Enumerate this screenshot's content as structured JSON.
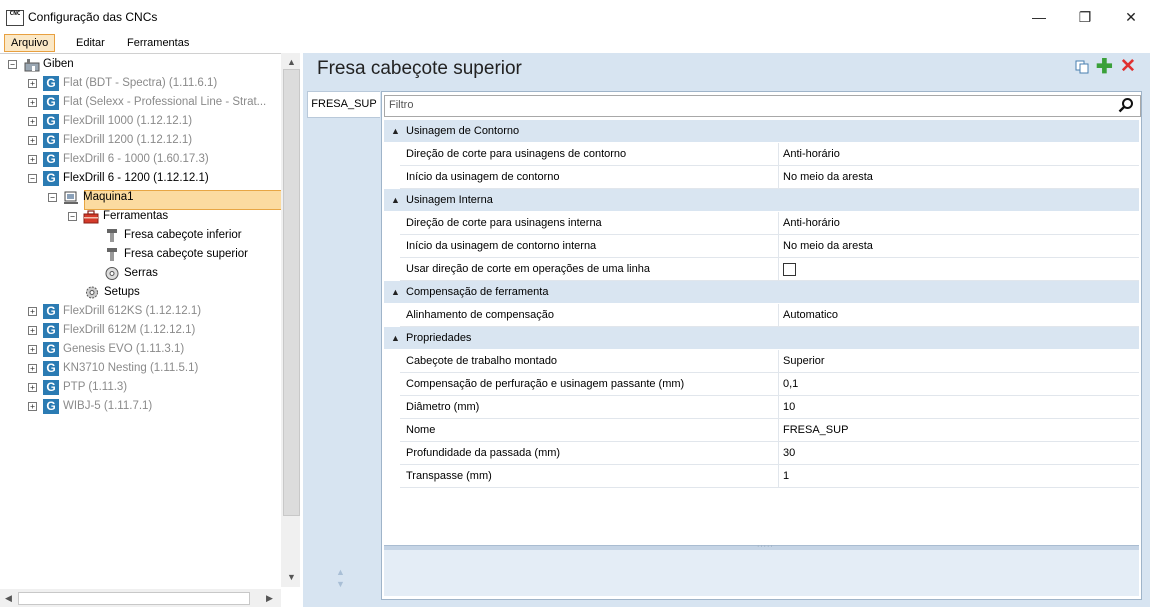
{
  "window": {
    "title": "Configuração das CNCs",
    "icon_text": "CNC",
    "controls": {
      "minimize": "—",
      "maximize": "❐",
      "close": "✕"
    }
  },
  "menu": [
    "Arquivo",
    "Editar",
    "Ferramentas"
  ],
  "tree": {
    "root": "Giben",
    "nodes": [
      {
        "label": "Flat (BDT - Spectra) (1.11.6.1)",
        "inactive": true
      },
      {
        "label": "Flat (Selexx - Professional Line - Strat...",
        "inactive": true
      },
      {
        "label": "FlexDrill 1000 (1.12.12.1)",
        "inactive": true
      },
      {
        "label": "FlexDrill 1200 (1.12.12.1)",
        "inactive": true
      },
      {
        "label": "FlexDrill 6 - 1000 (1.60.17.3)",
        "inactive": true
      },
      {
        "label": "FlexDrill 6 - 1200 (1.12.12.1)",
        "inactive": false
      }
    ],
    "machine": "Maquina1",
    "tools_folder": "Ferramentas",
    "tool_lower": "Fresa cabeçote inferior",
    "tool_upper": "Fresa cabeçote superior",
    "saws": "Serras",
    "setups": "Setups",
    "nodes_after": [
      "FlexDrill 612KS (1.12.12.1)",
      "FlexDrill 612M (1.12.12.1)",
      "Genesis EVO (1.11.3.1)",
      "KN3710 Nesting (1.11.5.1)",
      "PTP (1.11.3)",
      "WIBJ-5 (1.11.7.1)"
    ]
  },
  "panel": {
    "title": "Fresa cabeçote superior",
    "tab": "FRESA_SUP",
    "filter_placeholder": "Filtro",
    "categories": [
      {
        "label": "Usinagem de Contorno",
        "props": [
          {
            "name": "Direção de corte para usinagens de contorno",
            "value": "Anti-horário"
          },
          {
            "name": "Início da usinagem de contorno",
            "value": "No meio da aresta"
          }
        ]
      },
      {
        "label": "Usinagem Interna",
        "props": [
          {
            "name": "Direção de corte para usinagens interna",
            "value": "Anti-horário"
          },
          {
            "name": "Início da usinagem de contorno interna",
            "value": "No meio da aresta"
          },
          {
            "name": "Usar direção de corte em operações de uma linha",
            "value": "",
            "checkbox": true,
            "checked": false
          }
        ]
      },
      {
        "label": "Compensação de ferramenta",
        "props": [
          {
            "name": "Alinhamento de compensação",
            "value": "Automatico"
          }
        ]
      },
      {
        "label": "Propriedades",
        "props": [
          {
            "name": "Cabeçote de trabalho montado",
            "value": "Superior"
          },
          {
            "name": "Compensação de perfuração e usinagem passante (mm)",
            "value": "0,1"
          },
          {
            "name": "Diâmetro (mm)",
            "value": "10"
          },
          {
            "name": "Nome",
            "value": "FRESA_SUP"
          },
          {
            "name": "Profundidade da passada (mm)",
            "value": "30"
          },
          {
            "name": "Transpasse (mm)",
            "value": "1"
          }
        ]
      }
    ]
  },
  "colors": {
    "selection": "#fbdba0",
    "accent_blue": "#2b7bb3",
    "panel_bg": "#d7e4f1",
    "add": "#3aa03a",
    "delete": "#e03030"
  }
}
